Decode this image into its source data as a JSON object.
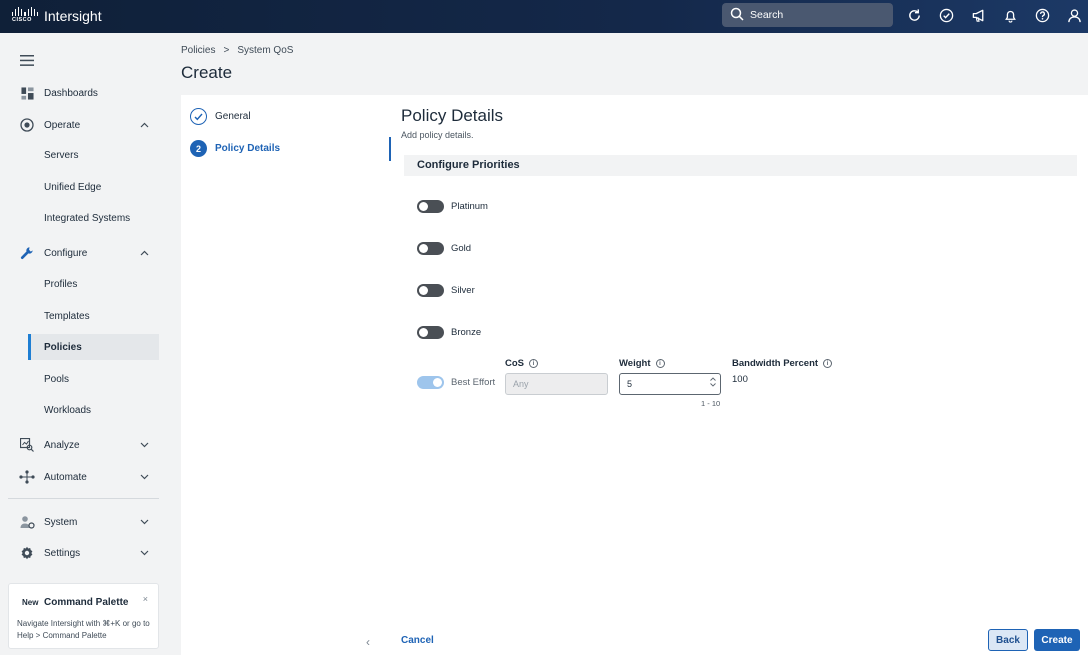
{
  "app": {
    "logo_word": "CISCO",
    "name": "Intersight"
  },
  "search": {
    "placeholder": "Search"
  },
  "top_icons": [
    "refresh-icon",
    "tasks-check-icon",
    "announcement-megaphone-icon",
    "notifications-bell-icon",
    "help-icon",
    "user-icon"
  ],
  "sidebar": {
    "items": [
      {
        "label": "Dashboards",
        "icon": "dashboard-icon"
      },
      {
        "label": "Operate",
        "icon": "operate-icon",
        "expanded": true,
        "children": [
          "Servers",
          "Unified Edge",
          "Integrated Systems"
        ]
      },
      {
        "label": "Configure",
        "icon": "wrench-icon",
        "expanded": true,
        "children": [
          "Profiles",
          "Templates",
          "Policies",
          "Pools",
          "Workloads"
        ]
      },
      {
        "label": "Analyze",
        "icon": "analyze-icon",
        "expanded": false
      },
      {
        "label": "Automate",
        "icon": "automate-icon",
        "expanded": false
      },
      {
        "label": "System",
        "icon": "system-icon",
        "expanded": false
      },
      {
        "label": "Settings",
        "icon": "gear-icon",
        "expanded": false
      }
    ],
    "active_child": "Policies"
  },
  "command_palette": {
    "tag": "New",
    "title": "Command Palette",
    "close": "×",
    "description": "Navigate Intersight with ⌘+K or go to Help > Command Palette"
  },
  "breadcrumb": [
    "Policies",
    "System QoS"
  ],
  "breadcrumb_separator": ">",
  "page_title": "Create",
  "steps": [
    {
      "label": "General",
      "state": "done"
    },
    {
      "number": "2",
      "label": "Policy Details",
      "state": "current"
    }
  ],
  "details": {
    "title": "Policy Details",
    "subtitle": "Add policy details.",
    "section_title": "Configure Priorities",
    "priorities": [
      {
        "label": "Platinum",
        "on": false
      },
      {
        "label": "Gold",
        "on": false
      },
      {
        "label": "Silver",
        "on": false
      },
      {
        "label": "Bronze",
        "on": false
      },
      {
        "label": "Best Effort",
        "on": true,
        "disabled": true
      }
    ],
    "cos": {
      "label": "CoS",
      "placeholder": "Any"
    },
    "weight": {
      "label": "Weight",
      "value": "5",
      "range": "1 - 10"
    },
    "bandwidth": {
      "label": "Bandwidth Percent",
      "value": "100"
    }
  },
  "footer": {
    "cancel": "Cancel",
    "back": "Back",
    "create": "Create",
    "prev_arrow": "‹"
  },
  "colors": {
    "accent": "#1e63b5",
    "topbar": "#0f2038"
  }
}
